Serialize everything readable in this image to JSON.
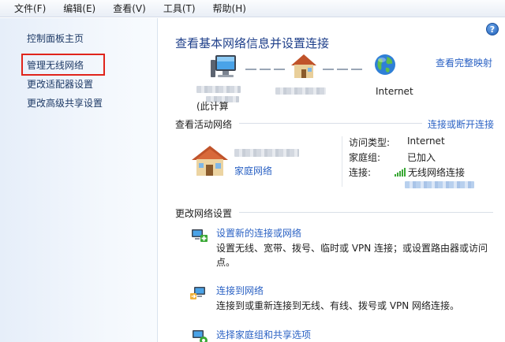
{
  "menu": [
    "文件(F)",
    "编辑(E)",
    "查看(V)",
    "工具(T)",
    "帮助(H)"
  ],
  "sidebar": {
    "home": "控制面板主页",
    "items": [
      "管理无线网络",
      "更改适配器设置",
      "更改高级共享设置"
    ]
  },
  "main": {
    "title": "查看基本网络信息并设置连接",
    "full_map": "查看完整映射",
    "help_glyph": "?",
    "map": {
      "computer_label": "(此计算",
      "internet_label": "Internet"
    },
    "active": {
      "heading": "查看活动网络",
      "connect_link": "连接或断开连接",
      "network_type": "家庭网络",
      "access_type_label": "访问类型:",
      "access_type_value": "Internet",
      "homegroup_label": "家庭组:",
      "homegroup_value": "已加入",
      "connection_label": "连接:",
      "connection_value": "无线网络连接"
    },
    "change": {
      "heading": "更改网络设置",
      "tasks": [
        {
          "link": "设置新的连接或网络",
          "desc": "设置无线、宽带、拨号、临时或 VPN 连接；或设置路由器或访问点。"
        },
        {
          "link": "连接到网络",
          "desc": "连接到或重新连接到无线、有线、拨号或 VPN 网络连接。"
        },
        {
          "link": "选择家庭组和共享选项",
          "desc": ""
        }
      ]
    }
  },
  "colors": {
    "highlight": "#e0241b",
    "link": "#2b62c4",
    "title": "#1e3f8a"
  }
}
